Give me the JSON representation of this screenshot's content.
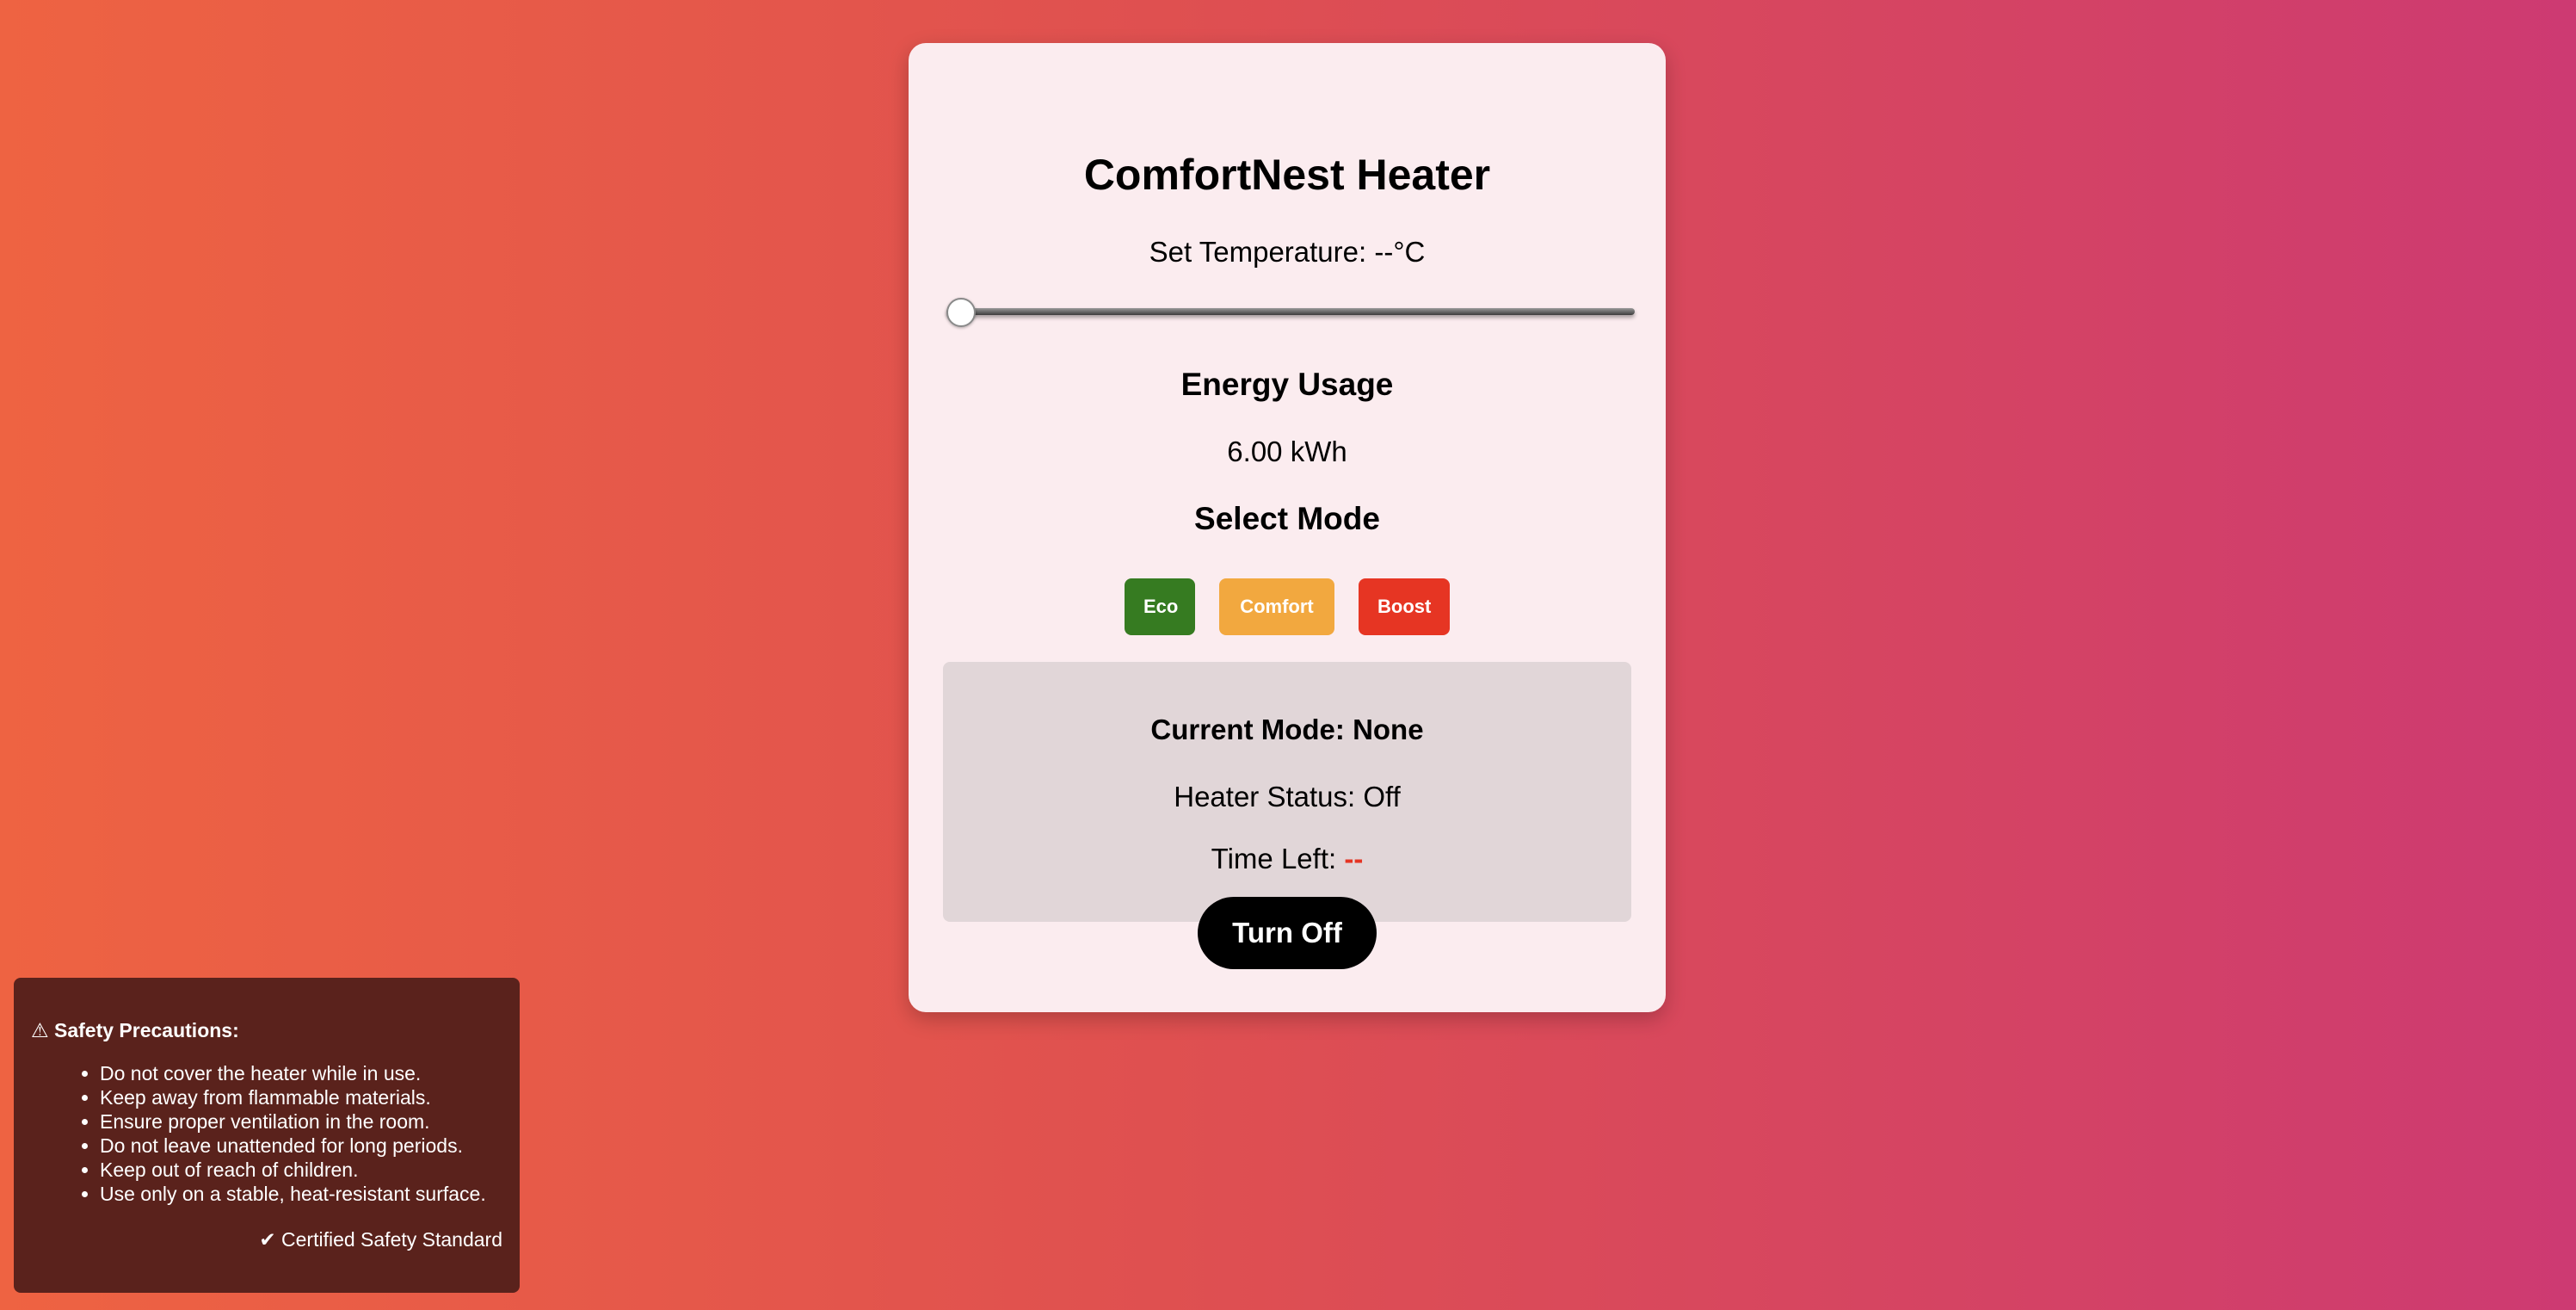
{
  "app": {
    "title": "ComfortNest Heater",
    "set_temperature_label": "Set Temperature: --°C",
    "slider_value": 0
  },
  "energy": {
    "heading": "Energy Usage",
    "value": "6.00 kWh"
  },
  "mode": {
    "heading": "Select Mode",
    "buttons": [
      {
        "label": "Eco",
        "color": "#367b21"
      },
      {
        "label": "Comfort",
        "color": "#f2a83f"
      },
      {
        "label": "Boost",
        "color": "#e63523"
      }
    ]
  },
  "status": {
    "current_mode": "Current Mode: None",
    "heater_status": "Heater Status: Off",
    "time_left_label": "Time Left:",
    "time_left_value": "--"
  },
  "controls": {
    "turn_off_label": "Turn Off"
  },
  "safety": {
    "title": "⚠ Safety Precautions:",
    "items": [
      "Do not cover the heater while in use.",
      "Keep away from flammable materials.",
      "Ensure proper ventilation in the room.",
      "Do not leave unattended for long periods.",
      "Keep out of reach of children.",
      "Use only on a stable, heat-resistant surface."
    ],
    "certified": "✔ Certified Safety Standard"
  }
}
